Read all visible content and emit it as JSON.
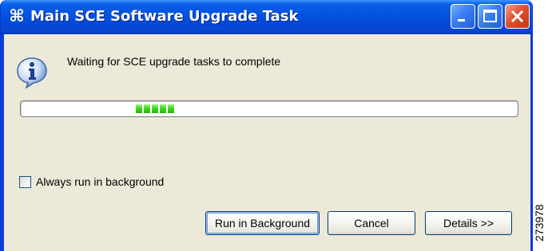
{
  "window": {
    "title": "Main SCE Software Upgrade Task",
    "title_icon": "command-icon",
    "controls": [
      "minimize-icon",
      "maximize-icon",
      "close-icon"
    ]
  },
  "status": {
    "icon": "info-icon",
    "message": "Waiting for SCE upgrade tasks to complete",
    "progress": {
      "type": "indeterminate",
      "segments": 5,
      "color": "#3fd61f"
    }
  },
  "options": {
    "always_background_label": "Always run in background",
    "always_background_checked": false
  },
  "buttons": {
    "run_in_background": "Run in Background",
    "cancel": "Cancel",
    "details": "Details >>"
  },
  "figure_id": "273978",
  "colors": {
    "titlebar": "#0553e1",
    "client_background": "#ece9d8",
    "close_button": "#e0502c"
  }
}
